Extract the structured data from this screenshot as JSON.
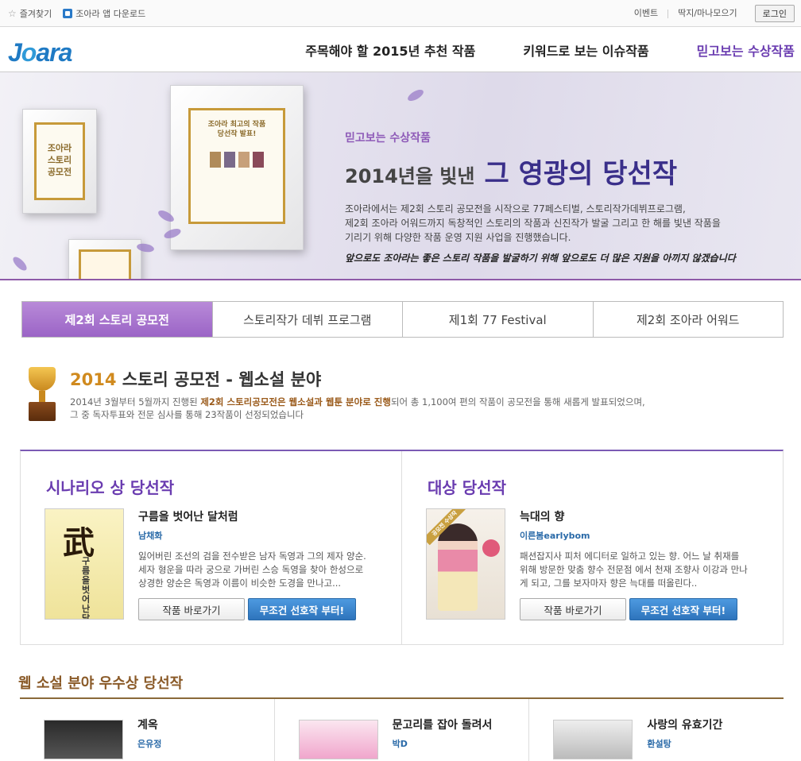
{
  "topbar": {
    "favorite": "즐겨찾기",
    "app_download": "조아라 앱 다운로드",
    "links": [
      "이벤트",
      "딱지/마나모으기"
    ],
    "login": "로그인"
  },
  "nav": {
    "logo": "Joara",
    "menu": [
      "주목해야 할 2015년 추천 작품",
      "키워드로 보는 이슈작품",
      "믿고보는 수상작품"
    ]
  },
  "hero": {
    "kicker": "믿고보는 수상작품",
    "headline_a": "2014년을 빛낸",
    "headline_b": "그 영광의 당선작",
    "desc_1": "조아라에서는 제2회 스토리 공모전을 시작으로 77페스티벌, 스토리작가데뷔프로그램,",
    "desc_2": "제2회 조아라 어워드까지 독창적인 스토리의 작품과 신진작가 발굴 그리고 한 해를 빛낸 작품을",
    "desc_3": "기리기 위해 다양한 작품 운영 지원 사업을 진행했습니다.",
    "desc_bold": "앞으로도 조아라는 좋은 스토리 작품을 발굴하기 위해 앞으로도 더 많은 지원을 아끼지 않겠습니다",
    "frame_left": "조아라\n스토리\n공모전",
    "frame_center": "조아라 최고의 작품\n당선작 발표!"
  },
  "tabs": [
    "제2회 스토리 공모전",
    "스토리작가 데뷔 프로그램",
    "제1회 77 Festival",
    "제2회 조아라 어워드"
  ],
  "contest": {
    "year": "2014",
    "title_rest": " 스토리 공모전 - 웹소설 분야",
    "body_1a": "2014년 3월부터 5월까지 진행된 ",
    "body_1b": "제2회 스토리공모전은 웹소설과 웹툰 분야로 진행",
    "body_1c": "되어 총 1,100여 편의 작품이 공모전을 통해 새롭게 발표되었으며,",
    "body_2": "그 중 독자투표와 전문 심사를 통해 23작품이 선정되었습니다"
  },
  "winners": [
    {
      "section": "시나리오 상 당선작",
      "title": "구름을 벗어난 달처럼",
      "author": "남채화",
      "desc": "잃어버린 조선의 검을 전수받은 남자 독영과 그의 제자 양순. 세자 형운을 따라 궁으로 가버린 스승 독영을 찾아 한성으로 상경한 양순은 독영과 이름이 비슷한 도경을 만나고...",
      "cover_char": "武",
      "cover_text": "구름을 벗어난 달처럼",
      "go_label": "작품 바로가기",
      "fav_label": "무조건 선호작 부터!"
    },
    {
      "section": "대상 당선작",
      "title": "늑대의 향",
      "author": "이른봄earlybom",
      "desc": "패션잡지사 피처 에디터로 일하고 있는 향. 어느 날 취재를 위해 방문한 맞춤 향수 전문점 에서 천재 조향사 이강과 만나게 되고, 그를 보자마자 향은 늑대를 떠올린다..",
      "ribbon": "공모전 수상작",
      "go_label": "작품 바로가기",
      "fav_label": "무조건 선호작 부터!"
    }
  ],
  "excellence": {
    "title": "웹 소설 분야 우수상 당선작",
    "items": [
      {
        "title": "계옥",
        "author": "은유정"
      },
      {
        "title": "문고리를 잡아 돌려서",
        "author": "박D"
      },
      {
        "title": "사랑의 유효기간",
        "author": "환설탕"
      }
    ]
  },
  "colors": {
    "accent": "#6a3cb0",
    "tab_active": "#9b64c6",
    "link": "#2a6aa8",
    "gold": "#d08a1e"
  }
}
